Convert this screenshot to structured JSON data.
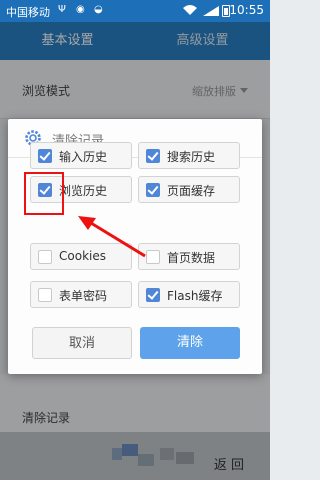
{
  "status_bar": {
    "carrier": "中国移动",
    "time": "10:55"
  },
  "tabs": [
    {
      "label": "基本设置"
    },
    {
      "label": "高级设置"
    }
  ],
  "settings": {
    "browse_mode_label": "浏览模式",
    "browse_mode_value": "缩放排版",
    "clear_records_label": "清除记录"
  },
  "dialog": {
    "title": "清除记录",
    "options": [
      {
        "label": "输入历史",
        "checked": true
      },
      {
        "label": "搜索历史",
        "checked": true
      },
      {
        "label": "浏览历史",
        "checked": true
      },
      {
        "label": "页面缓存",
        "checked": true
      },
      {
        "label": "Cookies",
        "checked": false
      },
      {
        "label": "首页数据",
        "checked": false
      },
      {
        "label": "表单密码",
        "checked": false
      },
      {
        "label": "Flash缓存",
        "checked": true
      }
    ],
    "cancel_label": "取消",
    "confirm_label": "清除"
  },
  "bottom": {
    "back_label": "返 回"
  },
  "colors": {
    "accent": "#2a80c5",
    "checkbox": "#4f86d8",
    "confirm_button": "#5da2ea",
    "annotation": "#ee1111"
  }
}
